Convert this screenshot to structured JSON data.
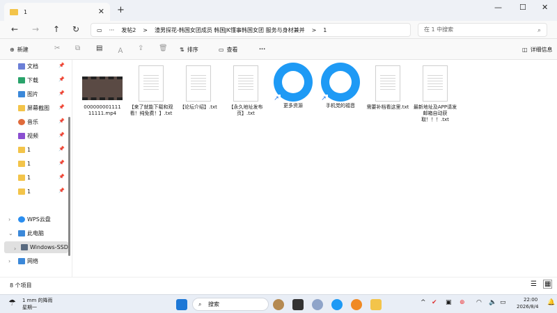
{
  "window": {
    "tab_title": "1",
    "new_tab": "+",
    "minimize": "—",
    "maximize": "☐",
    "close": "✕"
  },
  "address": {
    "breadcrumb": [
      "发帖2",
      ">",
      "渣男探花-韩国女团成员 韩国JK懂事韩国女团 服务与身材兼并",
      ">",
      "1"
    ],
    "search_placeholder": "在 1 中搜索"
  },
  "toolbar": {
    "new": "新建",
    "sort": "排序",
    "view": "查看",
    "more": "···",
    "details": "详细信息"
  },
  "sidebar": {
    "items": [
      {
        "label": "文档",
        "icon": "documents-icon",
        "color": "#6b7fd7"
      },
      {
        "label": "下载",
        "icon": "download-icon",
        "color": "#2aa36b"
      },
      {
        "label": "图片",
        "icon": "pictures-icon",
        "color": "#3b88d9"
      },
      {
        "label": "屏幕截图",
        "icon": "folder-icon",
        "color": "#f3c44a"
      },
      {
        "label": "音乐",
        "icon": "music-icon",
        "color": "#e06b3c"
      },
      {
        "label": "视频",
        "icon": "video-icon",
        "color": "#8b4fd1"
      },
      {
        "label": "1",
        "icon": "folder-icon",
        "color": "#f3c44a"
      },
      {
        "label": "1",
        "icon": "folder-icon",
        "color": "#f3c44a"
      },
      {
        "label": "1",
        "icon": "folder-icon",
        "color": "#f3c44a"
      },
      {
        "label": "1",
        "icon": "folder-icon",
        "color": "#f3c44a"
      }
    ],
    "wps": "WPS云盘",
    "pc": "此电脑",
    "ssd": "Windows-SSD",
    "network": "网络"
  },
  "files": [
    {
      "name": "000000001111 11111.mp4",
      "kind": "video"
    },
    {
      "name": "【来了就能下载和观看！纯免费！】.txt",
      "kind": "txt"
    },
    {
      "name": "【论坛介绍】.txt",
      "kind": "txt"
    },
    {
      "name": "【永久地址发布页】.txt",
      "kind": "txt"
    },
    {
      "name": "更多资源",
      "kind": "shortcut"
    },
    {
      "name": "手机党的福音",
      "kind": "shortcut"
    },
    {
      "name": "需要补档看这里.txt",
      "kind": "txt"
    },
    {
      "name": "最新地址及APP请发邮箱自动获取！！！.txt",
      "kind": "txt"
    }
  ],
  "status": {
    "count": "8 个项目"
  },
  "taskbar": {
    "weather_temp": "1 mm 的降雨",
    "weather_day": "星期一",
    "search": "搜索",
    "time": "22:00",
    "date": "2026/8/4"
  }
}
